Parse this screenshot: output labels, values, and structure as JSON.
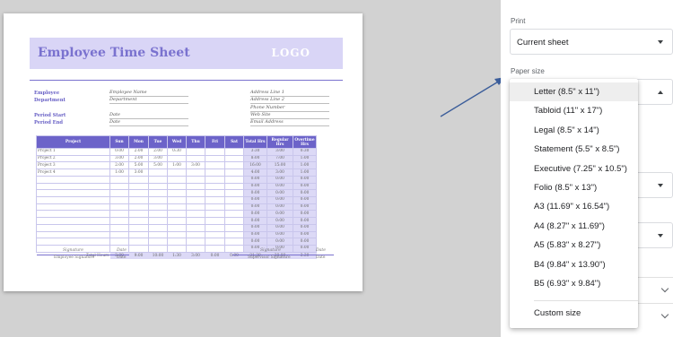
{
  "sheet": {
    "title": "Employee Time Sheet",
    "logo": "LOGO",
    "left_labels": [
      "Employee",
      "Department",
      "Period Start",
      "Period End"
    ],
    "left_values": [
      "Employee Name",
      "Department",
      "Date",
      "Date"
    ],
    "right_values": [
      "Address Line 1",
      "Address Line 2",
      "Phone Number",
      "Web Site",
      "Email Address"
    ],
    "table": {
      "headers": [
        "Project",
        "Sun",
        "Mon",
        "Tue",
        "Wed",
        "Thu",
        "Fri",
        "Sat",
        "Total Hrs",
        "Regular Hrs",
        "Overtime Hrs"
      ],
      "rows": [
        [
          "Project 1",
          "0:00",
          "2:00",
          "2:00",
          "0:30",
          "",
          "",
          "",
          "3:30",
          "3:00",
          "0:30"
        ],
        [
          "Project 2",
          "3:00",
          "2:00",
          "3:00",
          "",
          "",
          "",
          "",
          "8:00",
          "7:00",
          "1:00"
        ],
        [
          "Project 3",
          "2:00",
          "5:00",
          "5:00",
          "1:00",
          "3:00",
          "",
          "",
          "16:00",
          "15:00",
          "1:00"
        ],
        [
          "Project 4",
          "1:00",
          "3:00",
          "",
          "",
          "",
          "",
          "",
          "4:00",
          "3:00",
          "1:00"
        ],
        [
          "",
          "",
          "",
          "",
          "",
          "",
          "",
          "",
          "0:00",
          "0:00",
          "0:00"
        ],
        [
          "",
          "",
          "",
          "",
          "",
          "",
          "",
          "",
          "0:00",
          "0:00",
          "0:00"
        ],
        [
          "",
          "",
          "",
          "",
          "",
          "",
          "",
          "",
          "0:00",
          "0:00",
          "0:00"
        ],
        [
          "",
          "",
          "",
          "",
          "",
          "",
          "",
          "",
          "0:00",
          "0:00",
          "0:00"
        ],
        [
          "",
          "",
          "",
          "",
          "",
          "",
          "",
          "",
          "0:00",
          "0:00",
          "0:00"
        ],
        [
          "",
          "",
          "",
          "",
          "",
          "",
          "",
          "",
          "0:00",
          "0:00",
          "0:00"
        ],
        [
          "",
          "",
          "",
          "",
          "",
          "",
          "",
          "",
          "0:00",
          "0:00",
          "0:00"
        ],
        [
          "",
          "",
          "",
          "",
          "",
          "",
          "",
          "",
          "0:00",
          "0:00",
          "0:00"
        ],
        [
          "",
          "",
          "",
          "",
          "",
          "",
          "",
          "",
          "0:00",
          "0:00",
          "0:00"
        ],
        [
          "",
          "",
          "",
          "",
          "",
          "",
          "",
          "",
          "0:00",
          "0:00",
          "0:00"
        ],
        [
          "",
          "",
          "",
          "",
          "",
          "",
          "",
          "",
          "0:00",
          "0:00",
          "0:00"
        ]
      ],
      "totals_label": "Total Hours",
      "totals": [
        "3:00",
        "9:00",
        "10:00",
        "1:30",
        "3:00",
        "0:00",
        "0:00",
        "31:30",
        "28:00",
        "3:30"
      ]
    },
    "signatures": {
      "employee": {
        "sig": "Signature",
        "date": "Date",
        "caption": "Employee Signature",
        "date_caption": "Date"
      },
      "supervisor": {
        "sig": "Signature",
        "date": "Date",
        "caption": "Supervisor Signature",
        "date_caption": "Date"
      }
    }
  },
  "panel": {
    "print_label": "Print",
    "print_value": "Current sheet",
    "paper_size_label": "Paper size"
  },
  "menu": {
    "items": [
      "Letter (8.5\" x 11\")",
      "Tabloid (11\" x 17\")",
      "Legal (8.5\" x 14\")",
      "Statement (5.5\" x 8.5\")",
      "Executive (7.25\" x 10.5\")",
      "Folio (8.5\" x 13\")",
      "A3 (11.69\" x 16.54\")",
      "A4 (8.27\" x 11.69\")",
      "A5 (5.83\" x 8.27\")",
      "B4 (9.84\" x 13.90\")",
      "B5 (6.93\" x 9.84\")"
    ],
    "custom": "Custom size",
    "selected_index": 0
  },
  "colors": {
    "accent": "#6c63c9",
    "title_bg": "#d9d5f6",
    "arrow": "#3b5d9a"
  }
}
